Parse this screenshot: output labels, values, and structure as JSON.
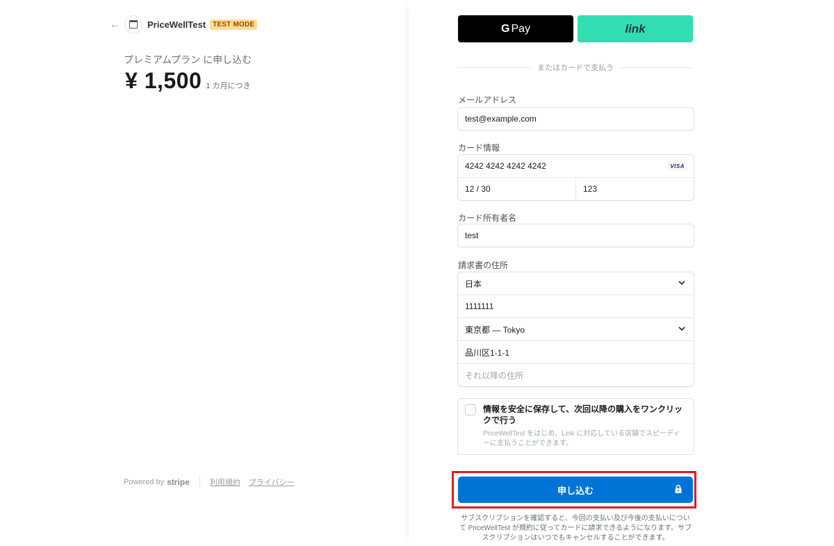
{
  "merchant": {
    "back_icon": "arrow-left-icon",
    "logo_icon": "store-icon",
    "name": "PriceWellTest",
    "badge": "TEST MODE"
  },
  "summary": {
    "plan_name": "プレミアムプラン に申し込む",
    "price": "¥ 1,500",
    "period": "1 カ月につき"
  },
  "footer": {
    "powered_by": "Powered by",
    "brand": "stripe",
    "terms": "利用規約",
    "privacy": "プライバシー"
  },
  "wallets": {
    "gpay_g": "G",
    "gpay_label": "Pay",
    "link_label": "link"
  },
  "divider_text": "またはカードで支払う",
  "form": {
    "email_label": "メールアドレス",
    "email_value": "test@example.com",
    "card_label": "カード情報",
    "card_number": "4242 4242 4242 4242",
    "card_brand": "VISA",
    "card_expiry": "12 / 30",
    "card_cvc": "123",
    "holder_label": "カード所有者名",
    "holder_value": "test",
    "address_label": "請求書の住所",
    "country": "日本",
    "postal_code": "1111111",
    "prefecture": "東京都 — Tokyo",
    "address_line1": "品川区1-1-1",
    "address_line2_placeholder": "それ以降の住所"
  },
  "save_info": {
    "title": "情報を安全に保存して、次回以降の購入をワンクリックで行う",
    "description": "PriceWellTest をはじめ、Link に対応している店舗でスピーディーに支払うことができます。"
  },
  "submit": {
    "label": "申し込む",
    "icon": "lock-icon"
  },
  "legal_text": "サブスクリプションを確認すると、今回の支払い及び今後の支払いについて PriceWellTest が規約に従ってカードに請求できるようになります。サブスクリプションはいつでもキャンセルすることができます。",
  "colors": {
    "accent": "#0074d4",
    "highlight_outline": "#e21b23",
    "link_green": "#33ddb3",
    "test_badge_bg": "#ffde92"
  }
}
